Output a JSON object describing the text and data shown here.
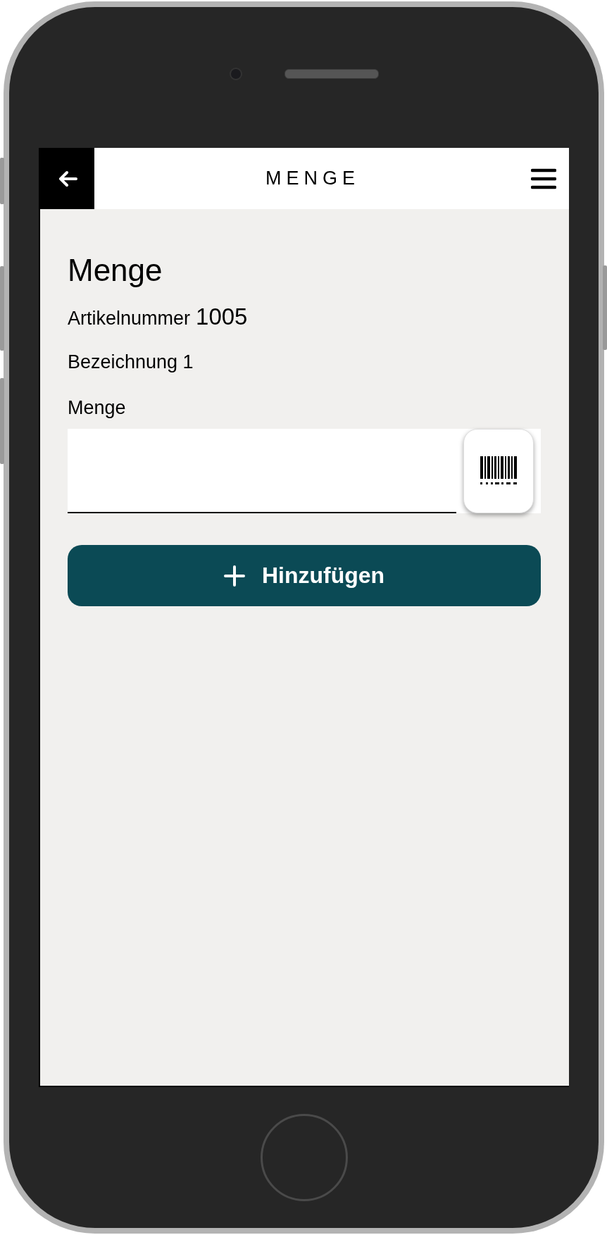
{
  "header": {
    "title": "MENGE"
  },
  "heading": "Menge",
  "article": {
    "label": "Artikelnummer",
    "number": "1005"
  },
  "description": "Bezeichnung 1",
  "quantity_field": {
    "label": "Menge"
  },
  "add_button": {
    "label": "Hinzufügen"
  }
}
